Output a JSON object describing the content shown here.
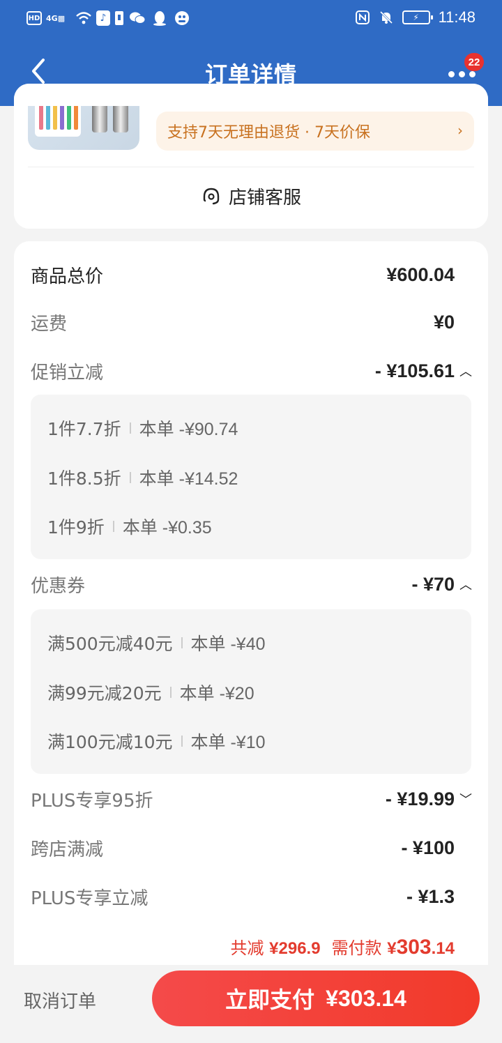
{
  "status_bar": {
    "left_icons": [
      "HD",
      "4G",
      "wifi-icon",
      "tiktok-icon",
      "sim-icon",
      "wechat-icon",
      "qq-icon",
      "bird-icon"
    ],
    "time": "11:48"
  },
  "nav": {
    "title": "订单详情",
    "badge": "22"
  },
  "product": {
    "return_policy": "支持7天无理由退货 · 7天价保",
    "service_label": "店铺客服"
  },
  "price": {
    "total_label": "商品总价",
    "total_value": "¥600.04",
    "shipping_label": "运费",
    "shipping_value": "¥0",
    "promo": {
      "label": "促销立减",
      "value": "- ¥105.61",
      "items": [
        {
          "name": "1件7.7折",
          "detail": "本单 -¥90.74"
        },
        {
          "name": "1件8.5折",
          "detail": "本单 -¥14.52"
        },
        {
          "name": "1件9折",
          "detail": "本单 -¥0.35"
        }
      ]
    },
    "coupon": {
      "label": "优惠券",
      "value": "- ¥70",
      "items": [
        {
          "name": "满500元减40元",
          "detail": "本单 -¥40"
        },
        {
          "name": "满99元减20元",
          "detail": "本单 -¥20"
        },
        {
          "name": "满100元减10元",
          "detail": "本单 -¥10"
        }
      ]
    },
    "plus95": {
      "label": "PLUS专享95折",
      "value": "- ¥19.99"
    },
    "cross_store": {
      "label": "跨店满减",
      "value": "- ¥100"
    },
    "plus_reduce": {
      "label": "PLUS专享立减",
      "value": "- ¥1.3"
    },
    "summary": {
      "total_reduce_label": "共减",
      "total_reduce_value": "¥296.9",
      "need_pay_label": "需付款",
      "need_pay_currency": "¥",
      "need_pay_int": "303",
      "need_pay_dec": ".14"
    }
  },
  "bottom": {
    "cancel_label": "取消订单",
    "pay_label": "立即支付",
    "pay_value": "¥303.14"
  },
  "colors": {
    "header": "#2f6bc5",
    "accent_red": "#e33b2e",
    "policy_text": "#c8711f"
  }
}
